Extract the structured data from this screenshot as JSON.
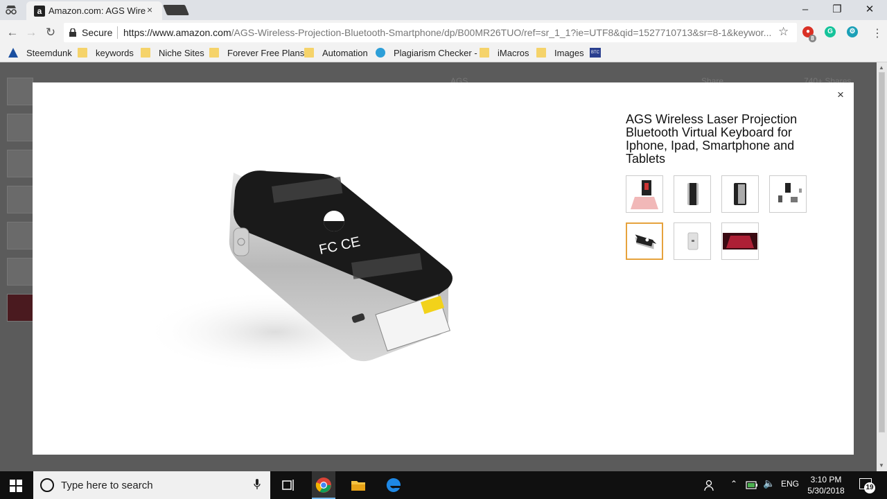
{
  "browser": {
    "tab_title": "Amazon.com: AGS Wireless Laser Projection Bluetooth Virtual Keyboard",
    "favicon_letter": "a",
    "tab_close": "×",
    "secure_label": "Secure",
    "url_domain": "https://www.amazon.com",
    "url_path": "/AGS-Wireless-Projection-Bluetooth-Smartphone/dp/B00MR26TUO/ref=sr_1_1?ie=UTF8&qid=1527710713&sr=8-1&keywor...",
    "ext_badge": "8",
    "ext_letter": "G"
  },
  "bookmarks": [
    {
      "label": "Steemdunk",
      "icon": "steemdunk-icon"
    },
    {
      "label": "keywords",
      "icon": "folder-icon"
    },
    {
      "label": "Niche Sites",
      "icon": "folder-icon"
    },
    {
      "label": "Forever Free Plans",
      "icon": "folder-icon"
    },
    {
      "label": "Automation",
      "icon": "folder-icon"
    },
    {
      "label": "Plagiarism Checker -",
      "icon": "plagiarism-icon"
    },
    {
      "label": "iMacros",
      "icon": "folder-icon"
    },
    {
      "label": "Images",
      "icon": "folder-icon"
    }
  ],
  "btc_label": "BTC",
  "background_page": {
    "brand": "AGS",
    "share": "Share",
    "shares_count": "740+ Shares"
  },
  "modal": {
    "close": "×",
    "title": "AGS Wireless Laser Projection Bluetooth Virtual Keyboard for Iphone, Ipad, Smartphone and Tablets",
    "selected_thumbnail_index": 4,
    "thumbnail_count": 7
  },
  "taskbar": {
    "search_placeholder": "Type here to search",
    "language": "ENG",
    "time": "3:10 PM",
    "date": "5/30/2018",
    "notification_count": "19"
  },
  "colors": {
    "selected_thumb_border": "#e6a23c",
    "overlay": "#5b5b5b",
    "taskbar": "#101010"
  }
}
